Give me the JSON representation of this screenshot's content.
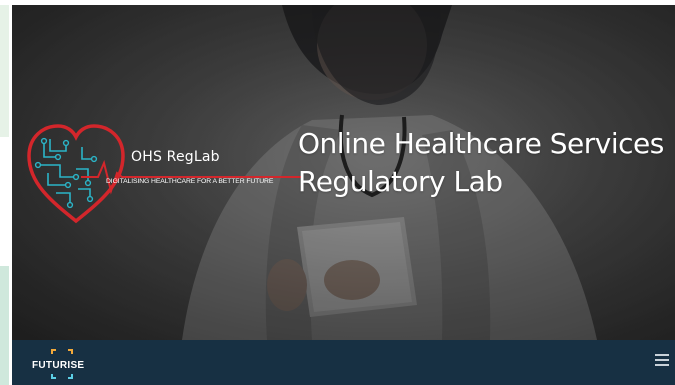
{
  "hero": {
    "title_line1": "Online Healthcare Services",
    "title_line2": "Regulatory Lab"
  },
  "logo": {
    "name": "OHS RegLab",
    "tagline": "DIGITALISING HEALTHCARE FOR A BETTER FUTURE"
  },
  "nav": {
    "brand": "FUTURISE",
    "menu_icon": "hamburger-menu-icon"
  },
  "colors": {
    "navbar": "#173043",
    "logo_red": "#d3262b",
    "logo_teal": "#2bb5c8",
    "left_strip_green": "#cfe8dc"
  }
}
